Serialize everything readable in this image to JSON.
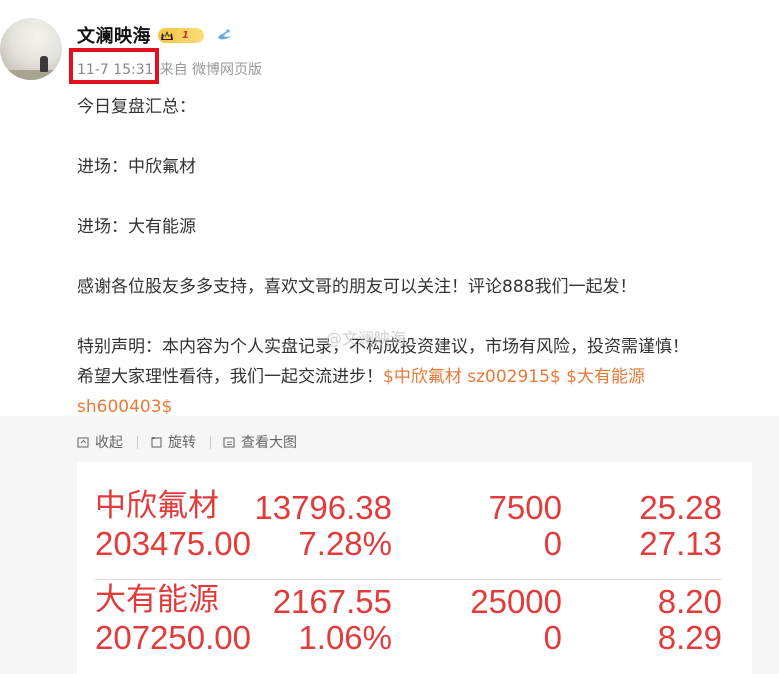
{
  "user": {
    "name": "文澜映海",
    "vip_level": "1"
  },
  "post_meta": {
    "time": "11-7 15:31",
    "source": "来自 微博网页版"
  },
  "post": {
    "line1": "今日复盘汇总：",
    "line2": "进场：中欣氟材",
    "line3": "进场：大有能源",
    "line4": "感谢各位股友多多支持，喜欢文哥的朋友可以关注！评论888我们一起发！",
    "line5": "特别声明：本内容为个人实盘记录，不构成投资建议，市场有风险，投资需谨慎！",
    "line6_text": "希望大家理性看待，我们一起交流进步！",
    "tag1": "$中欣氟材 sz002915$",
    "tag2": "$大有能源",
    "tag2_cont": "sh600403$"
  },
  "watermark": "@文澜映海",
  "toolbar": {
    "collapse": "收起",
    "rotate": "旋转",
    "view_large": "查看大图"
  },
  "stocks": [
    {
      "name": "中欣氟材",
      "price": "13796.38",
      "qty": "7500",
      "v1": "25.28",
      "amount": "203475.00",
      "pct": "7.28%",
      "q2": "0",
      "v2": "27.13"
    },
    {
      "name": "大有能源",
      "price": "2167.55",
      "qty": "25000",
      "v1": "8.20",
      "amount": "207250.00",
      "pct": "1.06%",
      "q2": "0",
      "v2": "8.29"
    }
  ],
  "colors": {
    "stock_red": "#e23b3b",
    "link_orange": "#e87a38",
    "highlight_red": "#e0111d"
  }
}
